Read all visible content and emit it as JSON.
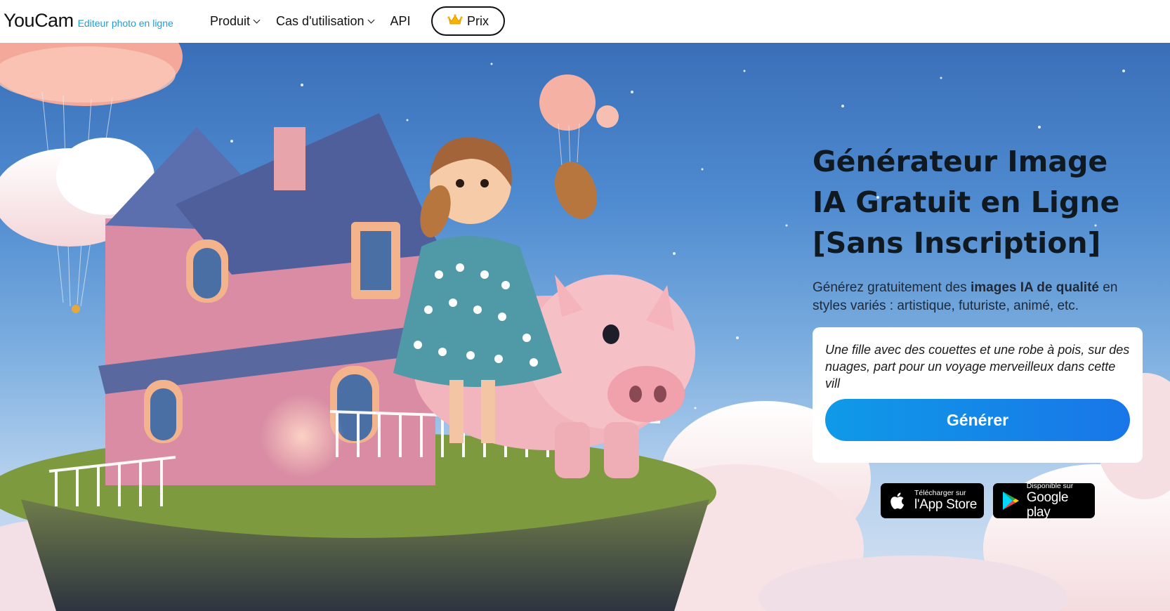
{
  "nav": {
    "logo": "YouCam",
    "logo_subtitle": "Editeur photo en ligne",
    "items": [
      {
        "label": "Produit",
        "has_dropdown": true
      },
      {
        "label": "Cas d'utilisation",
        "has_dropdown": true
      },
      {
        "label": "API",
        "has_dropdown": false
      }
    ],
    "pricing_label": "Prix",
    "pricing_icon": "crown-icon"
  },
  "hero": {
    "title": "Générateur Image IA Gratuit en Ligne [Sans Inscription]",
    "desc_before": "Générez gratuitement des ",
    "desc_bold": "images IA de qualité",
    "desc_after": " en styles variés : artistique, futuriste, animé, etc.",
    "prompt_text": "Une fille avec des couettes et une robe à pois, sur des nuages, part pour un voyage merveilleux dans cette vill",
    "generate_label": "Générer"
  },
  "stores": {
    "apple_small": "Télécharger sur",
    "apple_big": "l'App Store",
    "google_small": "Disponible sur",
    "google_big": "Google play"
  },
  "colors": {
    "accent": "#1a9fd8",
    "button_start": "#0f9ae8",
    "button_end": "#1976e8"
  }
}
